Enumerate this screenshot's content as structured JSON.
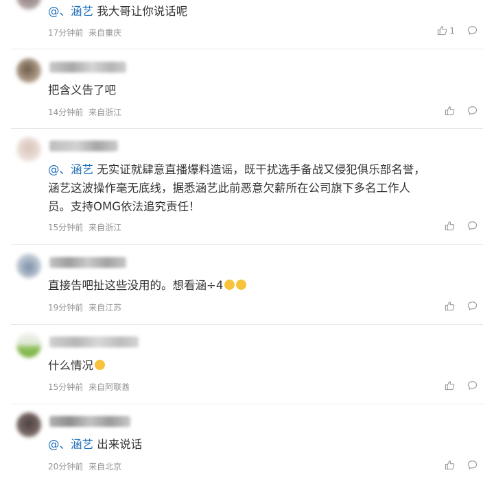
{
  "comments": [
    {
      "mention": "@、涵艺",
      "text": " 我大哥让你说话呢",
      "time": "17分钟前",
      "location": "来自重庆",
      "likes": "1"
    },
    {
      "text": "把含义告了吧",
      "time": "14分钟前",
      "location": "来自浙江",
      "likes": ""
    },
    {
      "mention": "@、涵艺",
      "lines": [
        " 无实证就肆意直播爆料造谣，既干扰选手备战又侵犯俱乐部名誉，",
        "涵艺这波操作毫无底线，据悉涵艺此前恶意欠薪所在公司旗下多名工作人",
        "员。支持OMG依法追究责任！"
      ],
      "time": "15分钟前",
      "location": "来自浙江",
      "likes": ""
    },
    {
      "text": "直接告吧扯这些没用的。想看涵÷4",
      "emoji": [
        "cat-emoji",
        "cat-emoji"
      ],
      "time": "19分钟前",
      "location": "来自江苏",
      "likes": ""
    },
    {
      "text": "什么情况",
      "emoji": [
        "crying-emoji"
      ],
      "time": "15分钟前",
      "location": "来自阿联酋",
      "likes": ""
    },
    {
      "mention": "@、涵艺",
      "text": " 出来说话",
      "time": "20分钟前",
      "location": "来自北京",
      "likes": ""
    }
  ],
  "colors": {
    "mention": "#1e6fb8",
    "text": "#333333",
    "meta": "#939393",
    "divider": "#e8e8e8"
  },
  "icons": {
    "like": "thumbs-up-icon",
    "reply": "comment-bubble-icon"
  }
}
